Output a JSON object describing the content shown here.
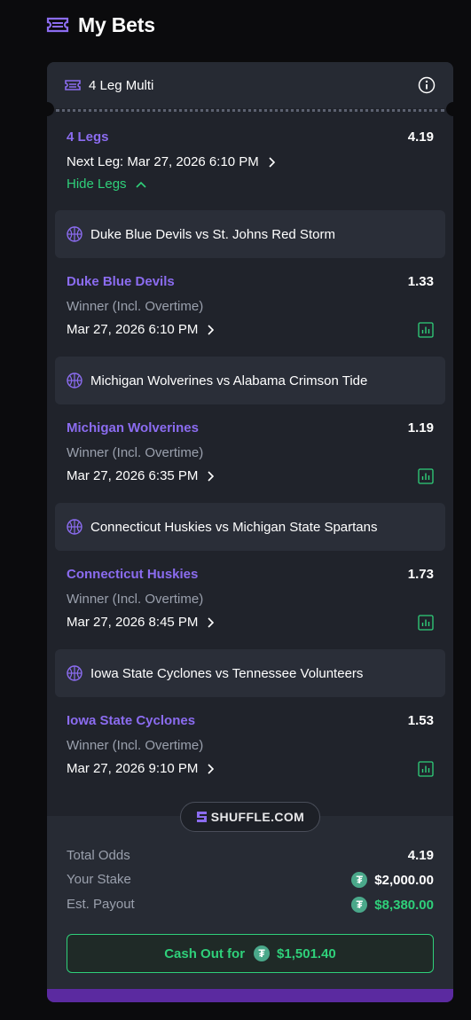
{
  "header": {
    "title": "My Bets"
  },
  "bet": {
    "type_label": "4 Leg Multi",
    "legs_label": "4 Legs",
    "total_odds": "4.19",
    "next_leg": "Next Leg: Mar 27, 2026 6:10 PM",
    "hide_legs": "Hide Legs"
  },
  "legs": [
    {
      "match": "Duke Blue Devils vs St. Johns Red Storm",
      "selection": "Duke Blue Devils",
      "odds": "1.33",
      "market": "Winner (Incl. Overtime)",
      "date": "Mar 27, 2026 6:10 PM"
    },
    {
      "match": "Michigan Wolverines vs Alabama Crimson Tide",
      "selection": "Michigan Wolverines",
      "odds": "1.19",
      "market": "Winner (Incl. Overtime)",
      "date": "Mar 27, 2026 6:35 PM"
    },
    {
      "match": "Connecticut Huskies vs Michigan State Spartans",
      "selection": "Connecticut Huskies",
      "odds": "1.73",
      "market": "Winner (Incl. Overtime)",
      "date": "Mar 27, 2026 8:45 PM"
    },
    {
      "match": "Iowa State Cyclones vs Tennessee Volunteers",
      "selection": "Iowa State Cyclones",
      "odds": "1.53",
      "market": "Winner (Incl. Overtime)",
      "date": "Mar 27, 2026 9:10 PM"
    }
  ],
  "brand": {
    "name": "SHUFFLE.COM"
  },
  "summary": {
    "total_odds_label": "Total Odds",
    "total_odds_value": "4.19",
    "stake_label": "Your Stake",
    "stake_value": "$2,000.00",
    "payout_label": "Est. Payout",
    "payout_value": "$8,380.00",
    "currency_symbol": "₮"
  },
  "cashout": {
    "label": "Cash Out for",
    "amount": "$1,501.40"
  },
  "colors": {
    "accent_purple": "#8b6cf0",
    "green": "#2fd07a",
    "coin": "#4aa88a",
    "background": "#0b0b0d",
    "card": "#20232b"
  },
  "icons": {
    "header": "ticket-icon",
    "info": "info-icon",
    "sport": "basketball-icon",
    "stats": "stats-chart-icon",
    "chevron": "chevron-right-icon",
    "currency": "tether-coin-icon"
  }
}
